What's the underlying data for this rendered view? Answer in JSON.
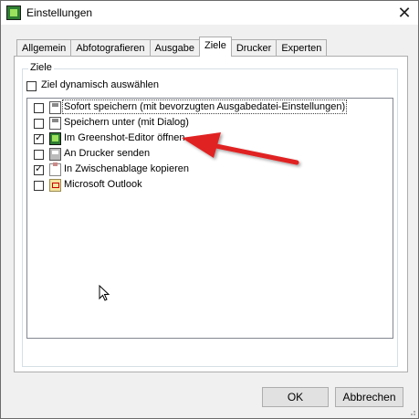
{
  "window": {
    "title": "Einstellungen"
  },
  "tabs": [
    {
      "label": "Allgemein",
      "active": false
    },
    {
      "label": "Abfotografieren",
      "active": false
    },
    {
      "label": "Ausgabe",
      "active": false
    },
    {
      "label": "Ziele",
      "active": true
    },
    {
      "label": "Drucker",
      "active": false
    },
    {
      "label": "Experten",
      "active": false
    }
  ],
  "group": {
    "label": "Ziele",
    "dynamic": {
      "label": "Ziel dynamisch auswählen",
      "checked": false
    }
  },
  "destinations": [
    {
      "label": "Sofort speichern (mit bevorzugten Ausgabedatei-Einstellungen)",
      "checked": false,
      "icon": "save-file-icon",
      "focused": true
    },
    {
      "label": "Speichern unter (mit Dialog)",
      "checked": false,
      "icon": "save-as-icon",
      "focused": false
    },
    {
      "label": "Im Greenshot-Editor öffnen",
      "checked": true,
      "icon": "greenshot-editor-icon",
      "focused": false
    },
    {
      "label": "An Drucker senden",
      "checked": false,
      "icon": "printer-icon",
      "focused": false
    },
    {
      "label": "In Zwischenablage kopieren",
      "checked": true,
      "icon": "clipboard-icon",
      "focused": false
    },
    {
      "label": "Microsoft Outlook",
      "checked": false,
      "icon": "outlook-icon",
      "focused": false
    }
  ],
  "buttons": {
    "ok": "OK",
    "cancel": "Abbrechen"
  },
  "colors": {
    "arrow": "#e02020"
  }
}
